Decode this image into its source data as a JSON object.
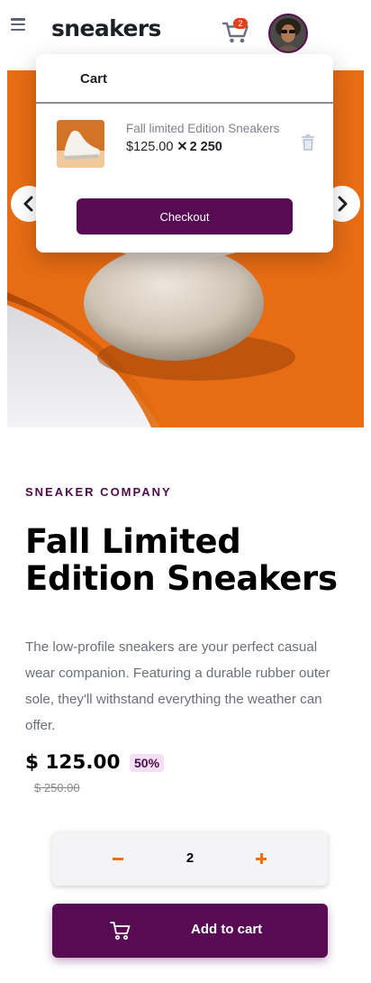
{
  "header": {
    "logo": "sneakers",
    "cart_count": "2"
  },
  "cart": {
    "title": "Cart",
    "item_name": "Fall limited Edition Sneakers",
    "item_unit_price": "$125.00",
    "item_multiplier": "✕",
    "item_total": "2 250",
    "checkout_label": "Checkout"
  },
  "product": {
    "company": "SNEAKER COMPANY",
    "title": "Fall Limited Edition Sneakers",
    "description": "The low-profile sneakers are your perfect casual wear companion. Featuring a durable rubber outer sole, they'll withstand everything the weather can offer.",
    "price": "$ 125.00",
    "discount": "50%",
    "old_price": "$ 250.00"
  },
  "quantity": {
    "value": "2"
  },
  "add_to_cart": {
    "label": "Add to cart"
  },
  "colors": {
    "brand": "#560b52",
    "accent": "#f0700f",
    "badge": "#e0431b"
  },
  "icons": [
    "menu-icon",
    "cart-icon",
    "avatar",
    "chevron-left-icon",
    "chevron-right-icon",
    "trash-icon",
    "minus-icon",
    "plus-icon"
  ]
}
